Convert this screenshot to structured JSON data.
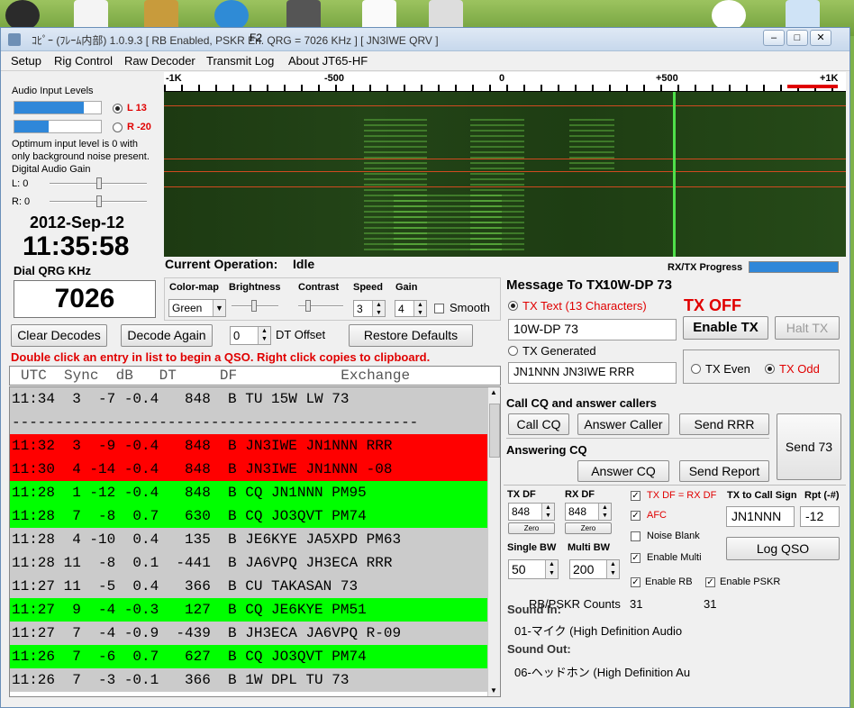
{
  "window": {
    "title": "ｺﾋﾟｰ (ﾌﾚｰﾑ内部)  1.0.9.3  [ RB Enabled, PSKR En.  QRG = 7026 KHz ] [ JN3IWE QRV ]",
    "overlay_label": "F2"
  },
  "menu": [
    "Setup",
    "Rig Control",
    "Raw Decoder",
    "Transmit Log",
    "About JT65-HF"
  ],
  "audio": {
    "title": "Audio Input Levels",
    "left_label": "L 13",
    "right_label": "R -20",
    "left_level": 0.8,
    "right_level": 0.4,
    "hint": "Optimum input level is 0 with only background noise present.",
    "gain_title": "Digital Audio Gain",
    "gain_l": "L: 0",
    "gain_r": "R: 0"
  },
  "clock": {
    "date": "2012-Sep-12",
    "time": "11:35:58",
    "qrg_label": "Dial QRG KHz",
    "qrg_value": "7026"
  },
  "waterfall": {
    "ticks": [
      "-1K",
      "-500",
      "0",
      "+500",
      "+1K"
    ],
    "rx_tx_label": "RX/TX Progress",
    "progress": 1.0
  },
  "operation": {
    "label": "Current Operation:",
    "value": "Idle"
  },
  "display": {
    "colormap_label": "Color-map",
    "colormap_value": "Green",
    "brightness_label": "Brightness",
    "contrast_label": "Contrast",
    "speed_label": "Speed",
    "speed_value": "3",
    "gain_label": "Gain",
    "gain_value": "4",
    "smooth_label": "Smooth"
  },
  "actions": {
    "clear": "Clear Decodes",
    "decode_again": "Decode Again",
    "dt_value": "0",
    "dt_label": "DT Offset",
    "restore": "Restore Defaults",
    "hint": "Double click an entry in list to begin a QSO.  Right click copies to clipboard."
  },
  "decode_header": "UTC  Sync  dB   DT     DF            Exchange",
  "decodes": [
    {
      "text": "11:34  3  -7 -0.4   848  B TU 15W LW 73",
      "color": "gray"
    },
    {
      "text": "-----------------------------------------------",
      "color": "gray"
    },
    {
      "text": "11:32  3  -9 -0.4   848  B JN3IWE JN1NNN RRR",
      "color": "red"
    },
    {
      "text": "11:30  4 -14 -0.4   848  B JN3IWE JN1NNN -08",
      "color": "red"
    },
    {
      "text": "11:28  1 -12 -0.4   848  B CQ JN1NNN PM95",
      "color": "green"
    },
    {
      "text": "11:28  7  -8  0.7   630  B CQ JO3QVT PM74",
      "color": "green"
    },
    {
      "text": "11:28  4 -10  0.4   135  B JE6KYE JA5XPD PM63",
      "color": "gray"
    },
    {
      "text": "11:28 11  -8  0.1  -441  B JA6VPQ JH3ECA RRR",
      "color": "gray"
    },
    {
      "text": "11:27 11  -5  0.4   366  B CU TAKASAN 73",
      "color": "gray"
    },
    {
      "text": "11:27  9  -4 -0.3   127  B CQ JE6KYE PM51",
      "color": "green"
    },
    {
      "text": "11:27  7  -4 -0.9  -439  B JH3ECA JA6VPQ R-09",
      "color": "gray"
    },
    {
      "text": "11:26  7  -6  0.7   627  B CQ JO3QVT PM74",
      "color": "green"
    },
    {
      "text": "11:26  7  -3 -0.1   366  B 1W DPL TU 73",
      "color": "gray"
    }
  ],
  "tx": {
    "message_label": "Message To TX:",
    "message_value": "10W-DP 73",
    "tx_text_label": "TX Text (13 Characters)",
    "status": "TX OFF",
    "tx_text_value": "10W-DP 73",
    "enable_tx": "Enable TX",
    "halt_tx": "Halt TX",
    "generated_label": "TX Generated",
    "generated_value": "JN1NNN JN3IWE RRR",
    "even_label": "TX Even",
    "odd_label": "TX Odd"
  },
  "cq": {
    "title": "Call CQ and answer callers",
    "call_cq": "Call CQ",
    "answer_caller": "Answer Caller",
    "send_rrr": "Send RRR",
    "send_73": "Send 73",
    "answering_title": "Answering CQ",
    "answer_cq": "Answer CQ",
    "send_report": "Send Report"
  },
  "params": {
    "txdf_label": "TX DF",
    "txdf_value": "848",
    "rxdf_label": "RX DF",
    "rxdf_value": "848",
    "zero": "Zero",
    "txdf_rxdf": "TX DF = RX DF",
    "afc": "AFC",
    "noise_blank": "Noise Blank",
    "enable_multi": "Enable Multi",
    "enable_rb": "Enable RB",
    "enable_pskr": "Enable PSKR",
    "single_bw_label": "Single BW",
    "single_bw_value": "50",
    "multi_bw_label": "Multi BW",
    "multi_bw_value": "200",
    "to_call_label": "TX to Call Sign",
    "to_call_value": "JN1NNN",
    "rpt_label": "Rpt (-#)",
    "rpt_value": "-12",
    "log_qso": "Log QSO"
  },
  "counts": {
    "label": "RB/PSKR Counts",
    "rb": "31",
    "pskr": "31"
  },
  "sound": {
    "in_label": "Sound In:",
    "in_value": "01-マイク (High Definition Audio",
    "out_label": "Sound Out:",
    "out_value": "06-ヘッドホン (High Definition Au"
  }
}
